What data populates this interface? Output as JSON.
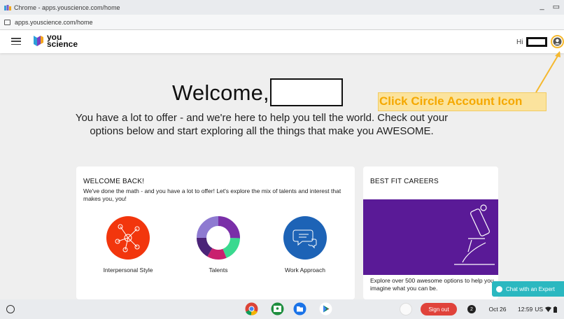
{
  "window": {
    "title": "Chrome - apps.youscience.com/home",
    "url": "apps.youscience.com/home"
  },
  "header": {
    "logo_line1": "you",
    "logo_line2": "science",
    "greeting": "Hi"
  },
  "main": {
    "welcome": "Welcome,",
    "intro": "You have a lot to offer - and we're here to help you tell the world. Check out your options below and start exploring all the things that make you AWESOME."
  },
  "annotation": {
    "text": "Click Circle Account Icon",
    "color": "#f5a800"
  },
  "welcome_card": {
    "title": "WELCOME BACK!",
    "text": "We've done the math - and you have a lot to offer! Let's explore the mix of talents and interest that makes you, you!",
    "dimensions": [
      {
        "label": "Interpersonal Style",
        "icon": "network-icon",
        "color": "#f2360d"
      },
      {
        "label": "Talents",
        "icon": "donut-chart-icon",
        "color": "#7a2fa8"
      },
      {
        "label": "Work Approach",
        "icon": "chat-bubbles-icon",
        "color": "#1d63b6"
      }
    ]
  },
  "careers_card": {
    "title": "BEST FIT CAREERS",
    "text": "Explore over 500 awesome options to help you imagine what you can be.",
    "art_color": "#5a1a97"
  },
  "chat": {
    "label": "Chat with an Expert"
  },
  "shelf": {
    "sign_out": "Sign out",
    "notifications": "2",
    "date": "Oct 26",
    "time": "12:59",
    "locale": "US"
  }
}
